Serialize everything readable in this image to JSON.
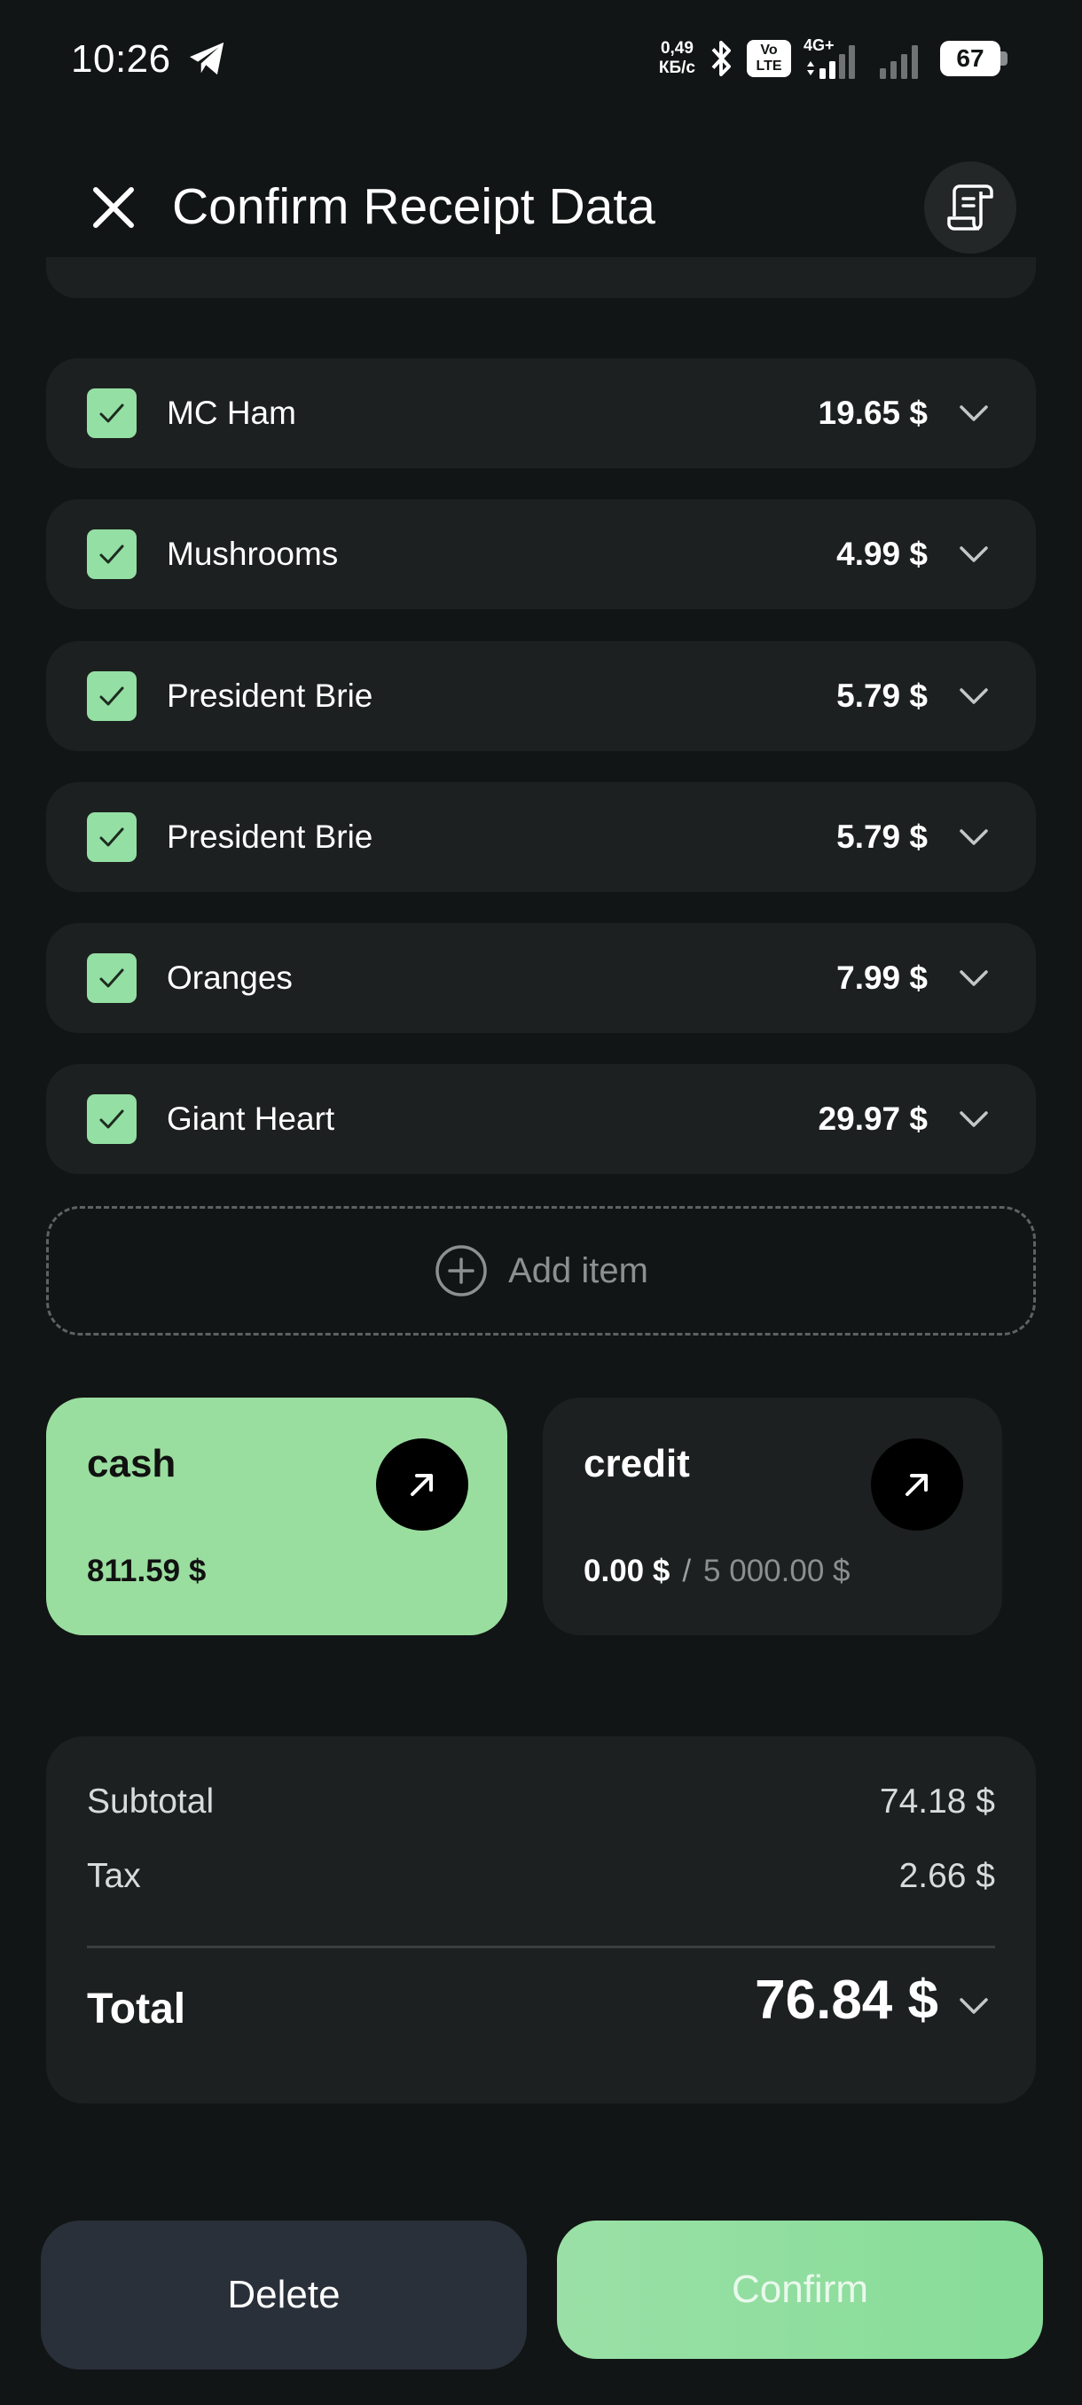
{
  "status_bar": {
    "time": "10:26",
    "speed_top": "0,49",
    "speed_bottom": "КБ/с",
    "volte_top": "Vo",
    "volte_bottom": "LTE",
    "network": "4G+",
    "battery": "67"
  },
  "header": {
    "title": "Confirm Receipt Data",
    "close_icon": "close-icon",
    "receipt_icon": "receipt-icon"
  },
  "items": [
    {
      "name": "MC Ham",
      "price": "19.65 $",
      "checked": true
    },
    {
      "name": "Mushrooms",
      "price": "4.99 $",
      "checked": true
    },
    {
      "name": "President Brie",
      "price": "5.79 $",
      "checked": true
    },
    {
      "name": "President Brie",
      "price": "5.79 $",
      "checked": true
    },
    {
      "name": "Oranges",
      "price": "7.99 $",
      "checked": true
    },
    {
      "name": "Giant Heart",
      "price": "29.97 $",
      "checked": true
    }
  ],
  "add_item": {
    "label": "Add item"
  },
  "accounts": [
    {
      "name": "cash",
      "balance": "811.59 $"
    },
    {
      "name": "credit",
      "balance": "0.00 $",
      "separator": "/",
      "limit": "5 000.00 $"
    }
  ],
  "summary": {
    "subtotal_label": "Subtotal",
    "subtotal_value": "74.18 $",
    "tax_label": "Tax",
    "tax_value": "2.66 $",
    "total_label": "Total",
    "total_value": "76.84 $"
  },
  "actions": {
    "delete_label": "Delete",
    "confirm_label": "Confirm"
  },
  "colors": {
    "background": "#121515",
    "card": "#1d2020",
    "accent_green": "#94dfa3",
    "delete_button": "#2a303a"
  }
}
